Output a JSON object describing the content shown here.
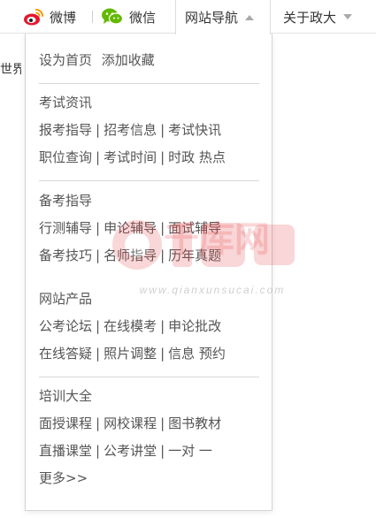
{
  "topbar": {
    "weibo": {
      "label": "微博",
      "icon": "weibo-icon"
    },
    "weixin": {
      "label": "微信",
      "icon": "wechat-icon"
    },
    "site_nav": {
      "label": "网站导航",
      "icon": "caret-up-icon"
    },
    "about": {
      "label": "关于政大",
      "icon": "caret-down-icon"
    }
  },
  "page_fragment": "世界",
  "dropdown": {
    "quick_links": [
      "设为首页",
      "添加收藏"
    ],
    "sections": [
      {
        "title": "考试资讯",
        "rows": [
          [
            "报考指导",
            "招考信息",
            "考试快讯"
          ],
          [
            "职位查询",
            "考试时间",
            "时政 热点"
          ]
        ]
      },
      {
        "title": "备考指导",
        "rows": [
          [
            "行测辅导",
            "申论辅导",
            "面试辅导"
          ],
          [
            "备考技巧",
            "名师指导",
            "历年真题"
          ]
        ]
      },
      {
        "title": "网站产品",
        "rows": [
          [
            "公考论坛",
            "在线模考",
            "申论批改"
          ],
          [
            "在线答疑",
            "照片调整",
            "信息 预约"
          ]
        ]
      },
      {
        "title": "培训大全",
        "rows": [
          [
            "面授课程",
            "网校课程",
            "图书教材"
          ],
          [
            "直播课堂",
            "公考讲堂",
            "一对 一"
          ]
        ]
      }
    ],
    "more_label": "更多>>",
    "separator": "|"
  },
  "watermark": {
    "brand": "千库网",
    "url": "www.qianxunsucai.com"
  },
  "colors": {
    "text": "#555555",
    "border": "#d4d4d4",
    "weibo_red": "#e6162d",
    "wechat_green": "#62b900",
    "watermark_red": "#e8474d"
  }
}
